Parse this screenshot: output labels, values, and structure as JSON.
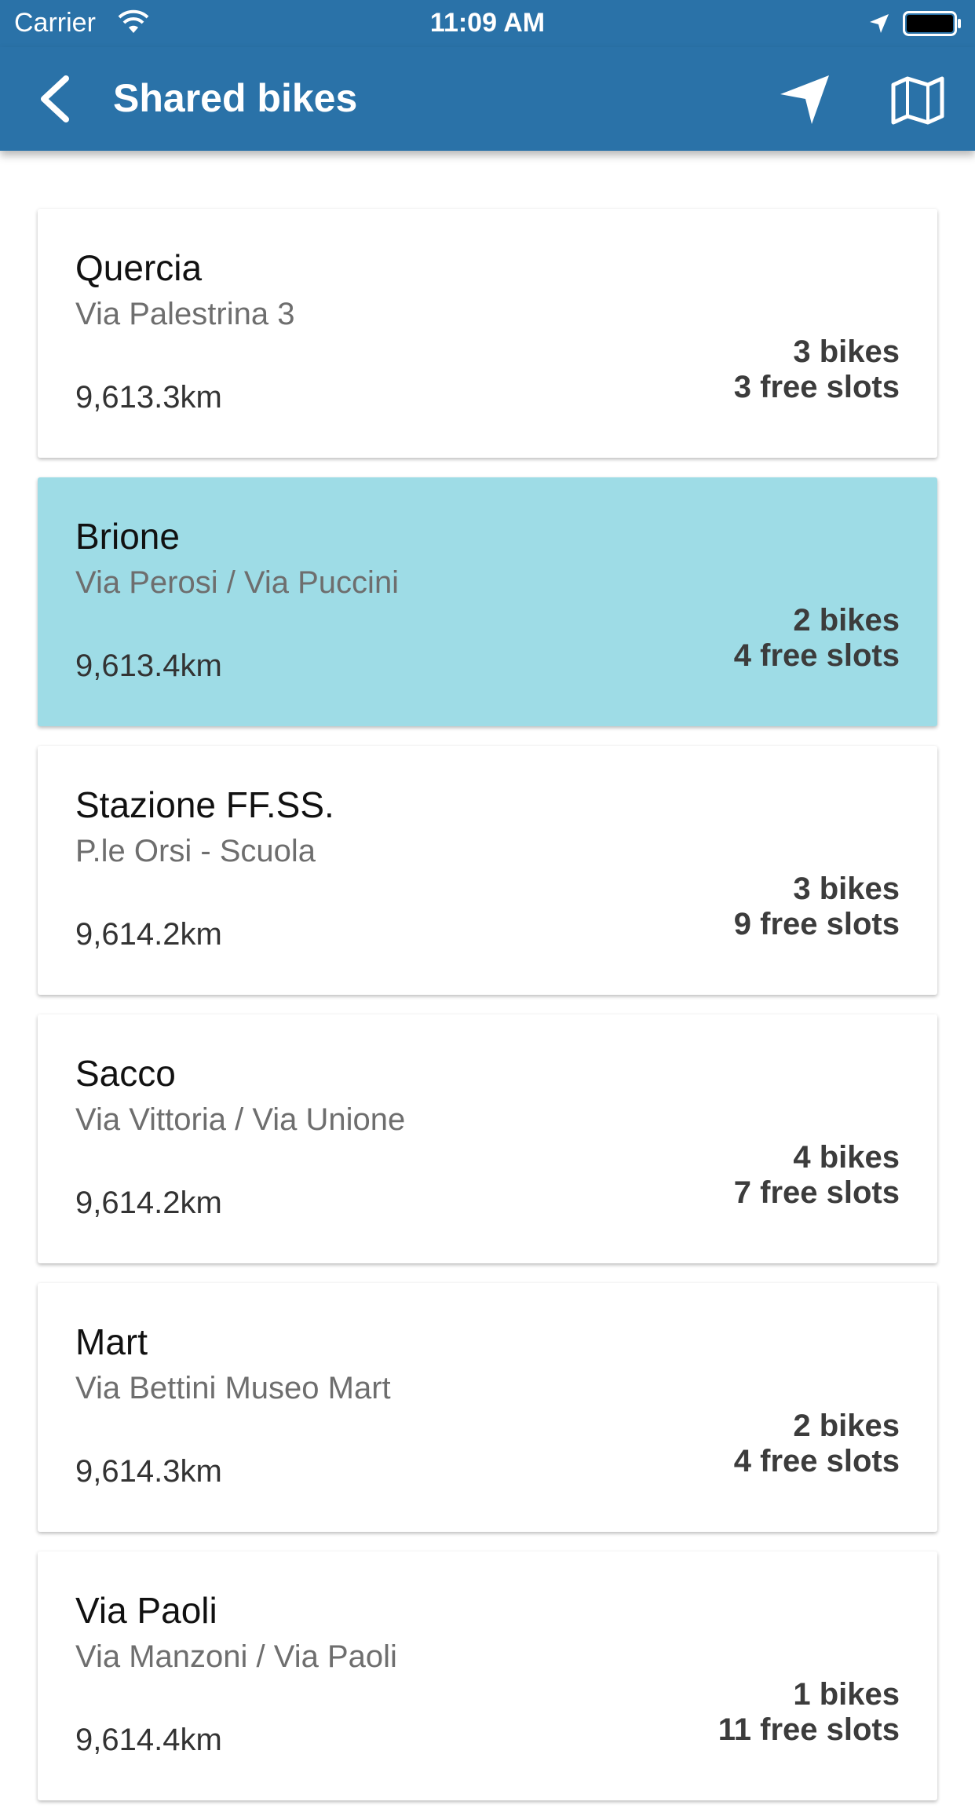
{
  "status_bar": {
    "carrier": "Carrier",
    "time": "11:09 AM"
  },
  "app_bar": {
    "title": "Shared bikes",
    "color": "#2a72a8"
  },
  "selected_color": "#9edce6",
  "stations": [
    {
      "name": "Quercia",
      "address": "Via Palestrina 3",
      "distance": "9,613.3km",
      "bikes": "3 bikes",
      "slots": "3 free slots",
      "selected": false
    },
    {
      "name": "Brione",
      "address": "Via Perosi / Via Puccini",
      "distance": "9,613.4km",
      "bikes": "2 bikes",
      "slots": "4 free slots",
      "selected": true
    },
    {
      "name": "Stazione FF.SS.",
      "address": "P.le Orsi - Scuola",
      "distance": "9,614.2km",
      "bikes": "3 bikes",
      "slots": "9 free slots",
      "selected": false
    },
    {
      "name": "Sacco",
      "address": "Via Vittoria / Via Unione",
      "distance": "9,614.2km",
      "bikes": "4 bikes",
      "slots": "7 free slots",
      "selected": false
    },
    {
      "name": "Mart",
      "address": "Via Bettini Museo Mart",
      "distance": "9,614.3km",
      "bikes": "2 bikes",
      "slots": "4 free slots",
      "selected": false
    },
    {
      "name": "Via Paoli",
      "address": "Via Manzoni / Via Paoli",
      "distance": "9,614.4km",
      "bikes": "1 bikes",
      "slots": "11 free slots",
      "selected": false
    }
  ]
}
